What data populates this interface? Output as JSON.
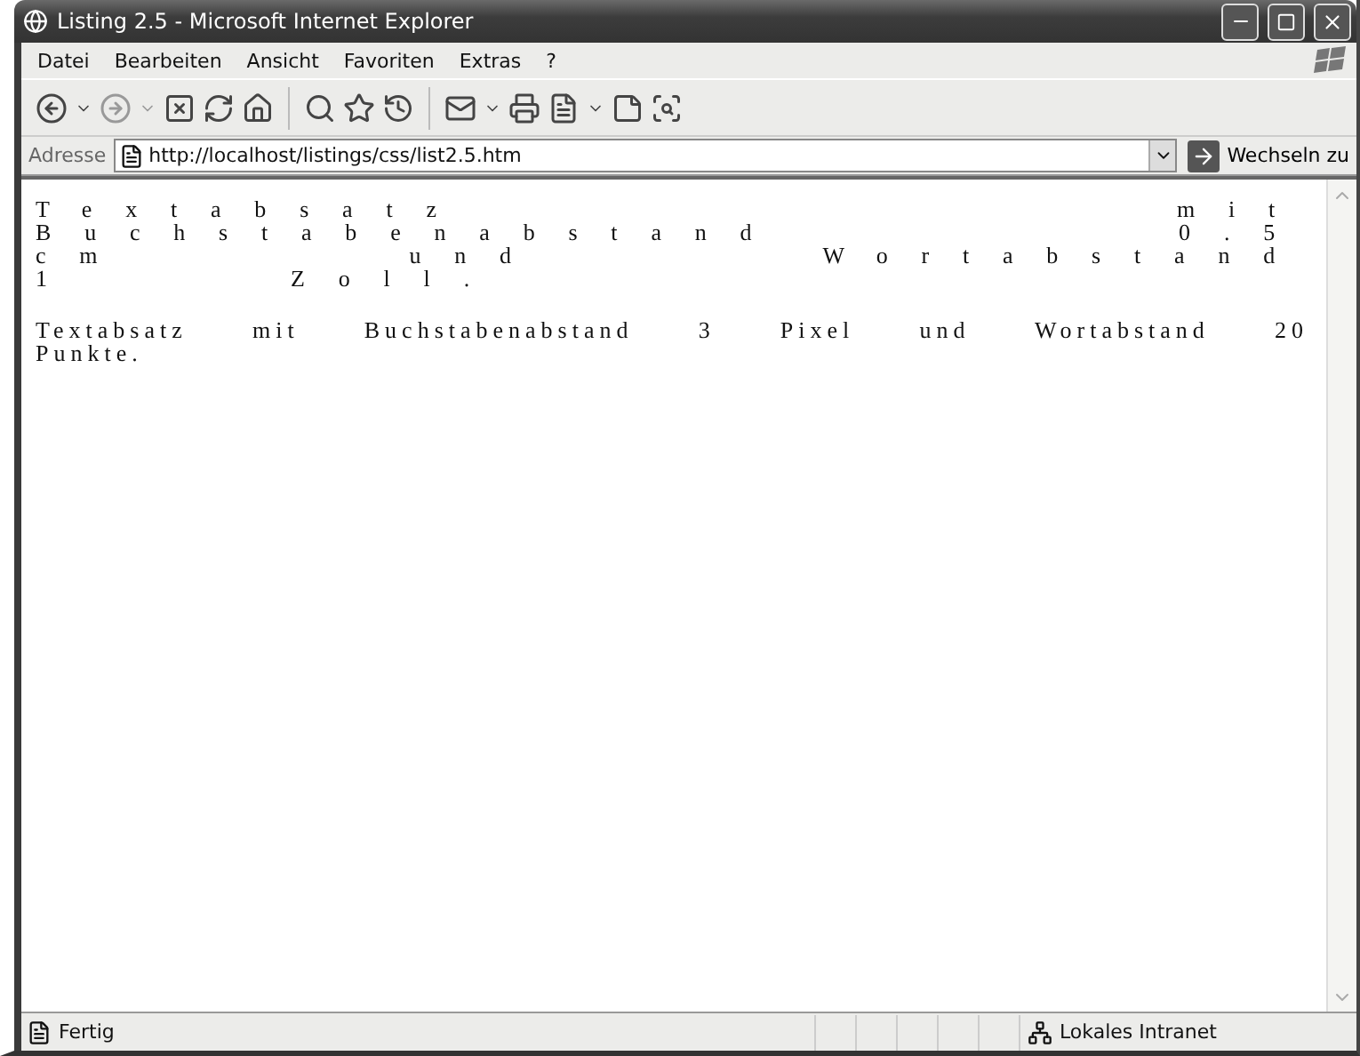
{
  "window": {
    "title": "Listing 2.5 - Microsoft Internet Explorer"
  },
  "menu": [
    "Datei",
    "Bearbeiten",
    "Ansicht",
    "Favoriten",
    "Extras",
    "?"
  ],
  "address": {
    "label": "Adresse",
    "value": "http://localhost/listings/css/list2.5.htm",
    "go_button": "Wechseln zu"
  },
  "paragraphs": [
    {
      "kind": "wide",
      "text": "Textabsatz mit Buchstabenabstand 0.5 cm und Wortabstand 1 Zoll."
    },
    {
      "kind": "narrow",
      "text": "Textabsatz mit Buchstabenabstand 3 Pixel und Wortabstand 20 Punkte."
    }
  ],
  "status_bar": {
    "status": "Fertig",
    "zone": "Lokales Intranet"
  }
}
